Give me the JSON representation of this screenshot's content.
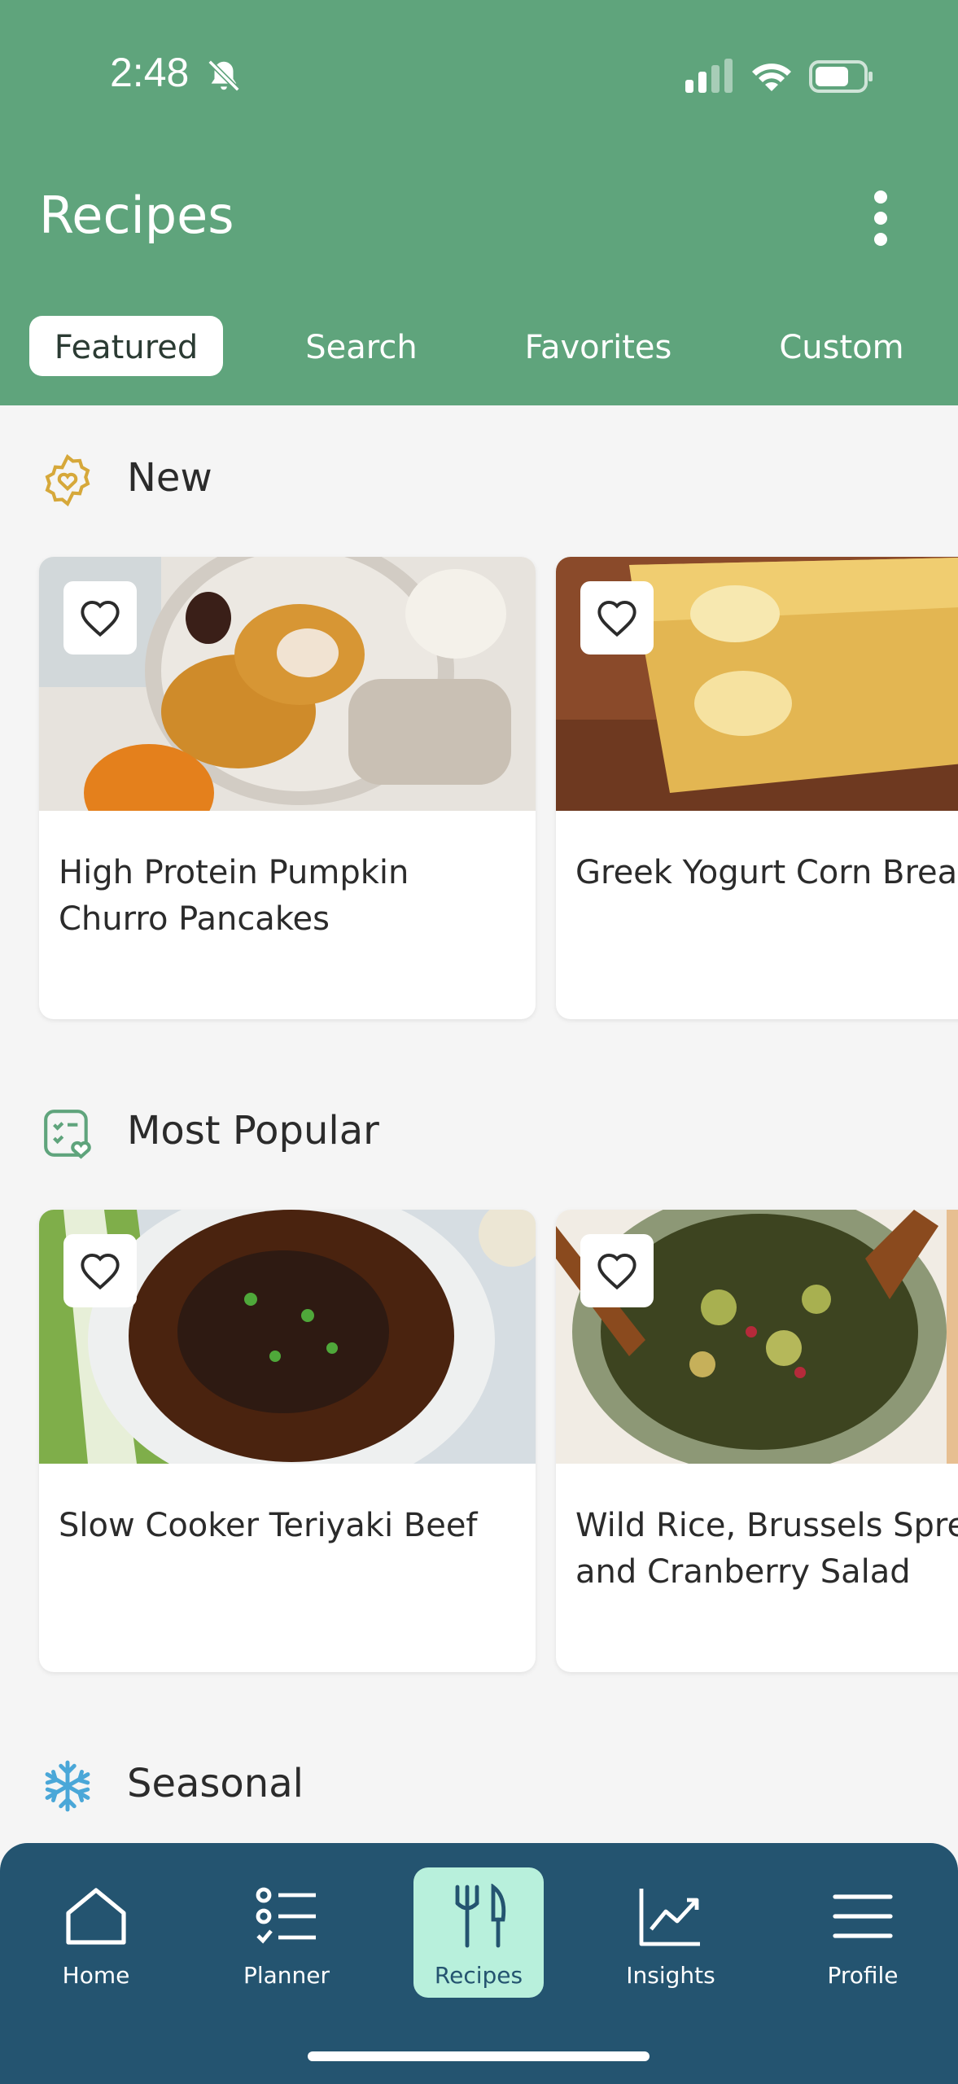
{
  "status_bar": {
    "time": "2:48"
  },
  "header": {
    "title": "Recipes"
  },
  "tabs": [
    {
      "label": "Featured",
      "active": true
    },
    {
      "label": "Search",
      "active": false
    },
    {
      "label": "Favorites",
      "active": false
    },
    {
      "label": "Custom",
      "active": false
    }
  ],
  "sections": [
    {
      "title": "New",
      "icon": "badge-heart-icon",
      "cards": [
        {
          "title": "High Protein Pumpkin Churro Pancakes"
        },
        {
          "title": "Greek Yogurt Corn Brea"
        }
      ]
    },
    {
      "title": "Most Popular",
      "icon": "checklist-heart-icon",
      "cards": [
        {
          "title": "Slow Cooker Teriyaki Beef"
        },
        {
          "title": "Wild Rice, Brussels Spre and Cranberry Salad"
        }
      ]
    },
    {
      "title": "Seasonal",
      "icon": "snowflake-icon",
      "cards": []
    }
  ],
  "bottom_nav": [
    {
      "label": "Home",
      "icon": "home-icon",
      "active": false
    },
    {
      "label": "Planner",
      "icon": "planner-list-icon",
      "active": false
    },
    {
      "label": "Recipes",
      "icon": "fork-knife-icon",
      "active": true
    },
    {
      "label": "Insights",
      "icon": "chart-line-icon",
      "active": false
    },
    {
      "label": "Profile",
      "icon": "hamburger-menu-icon",
      "active": false
    }
  ],
  "colors": {
    "header_green": "#5fa47c",
    "nav_blue": "#245470",
    "active_mint": "#b8f0dc",
    "new_icon_gold": "#d6a83a",
    "popular_icon_green": "#5fa47c",
    "seasonal_icon_blue": "#4aa7d8"
  }
}
